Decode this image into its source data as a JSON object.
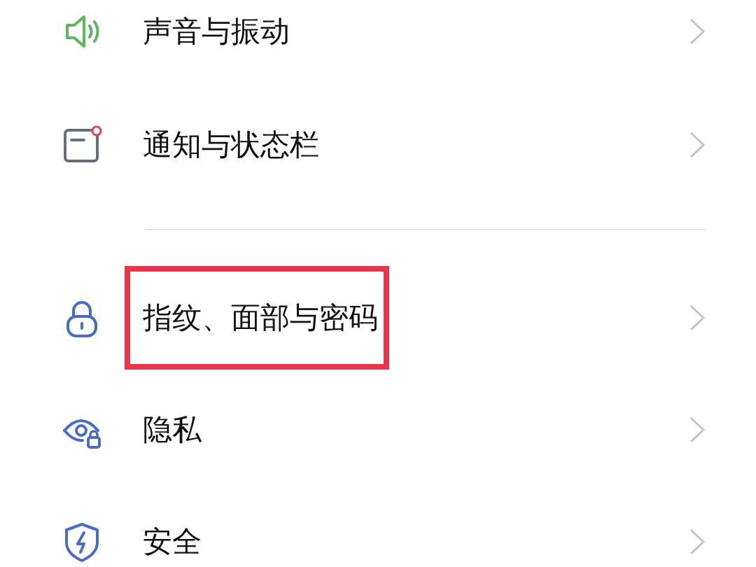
{
  "settings_groups": [
    {
      "items": [
        {
          "label": "声音与振动",
          "highlighted": false
        },
        {
          "label": "通知与状态栏",
          "highlighted": false
        }
      ]
    },
    {
      "items": [
        {
          "label": "指纹、面部与密码",
          "highlighted": true
        },
        {
          "label": "隐私",
          "highlighted": false
        },
        {
          "label": "安全",
          "highlighted": false
        }
      ]
    }
  ]
}
